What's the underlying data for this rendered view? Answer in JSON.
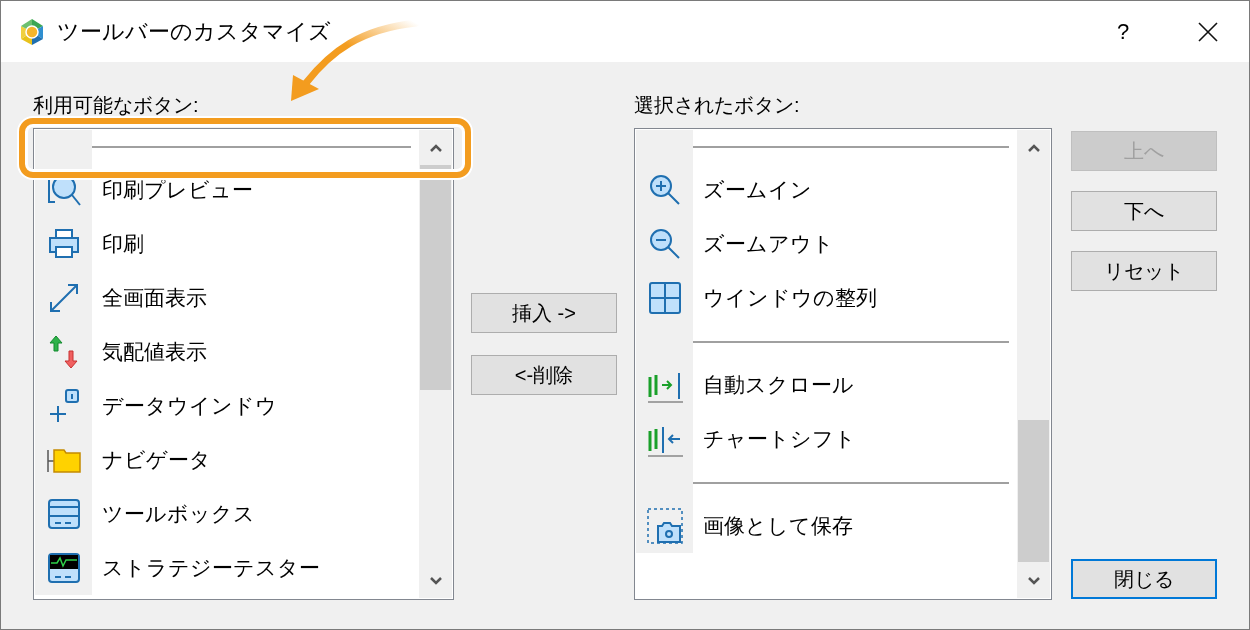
{
  "window": {
    "title": "ツールバーのカスタマイズ",
    "help": "?"
  },
  "available": {
    "label": "利用可能なボタン:",
    "items": [
      {
        "kind": "separator"
      },
      {
        "kind": "item",
        "label": "印刷プレビュー"
      },
      {
        "kind": "item",
        "label": "印刷"
      },
      {
        "kind": "item",
        "label": "全画面表示"
      },
      {
        "kind": "item",
        "label": "気配値表示"
      },
      {
        "kind": "item",
        "label": "データウインドウ"
      },
      {
        "kind": "item",
        "label": "ナビゲータ"
      },
      {
        "kind": "item",
        "label": "ツールボックス"
      },
      {
        "kind": "item",
        "label": "ストラテジーテスター"
      }
    ]
  },
  "actions": [
    {
      "label": "挿入 ->"
    },
    {
      "label": "<-削除"
    }
  ],
  "selected": {
    "label": "選択されたボタン:",
    "items": [
      {
        "kind": "separator"
      },
      {
        "kind": "item",
        "label": "ズームイン"
      },
      {
        "kind": "item",
        "label": "ズームアウト"
      },
      {
        "kind": "item",
        "label": "ウインドウの整列"
      },
      {
        "kind": "separator"
      },
      {
        "kind": "item",
        "label": "自動スクロール"
      },
      {
        "kind": "item",
        "label": "チャートシフト"
      },
      {
        "kind": "separator"
      },
      {
        "kind": "item",
        "label": "画像として保存"
      }
    ]
  },
  "side_buttons": [
    {
      "label": "上へ",
      "disabled": true,
      "default": false
    },
    {
      "label": "下へ",
      "disabled": false,
      "default": false
    },
    {
      "label": "リセット",
      "disabled": false,
      "default": false
    },
    {
      "label": "閉じる",
      "disabled": false,
      "default": true
    }
  ]
}
